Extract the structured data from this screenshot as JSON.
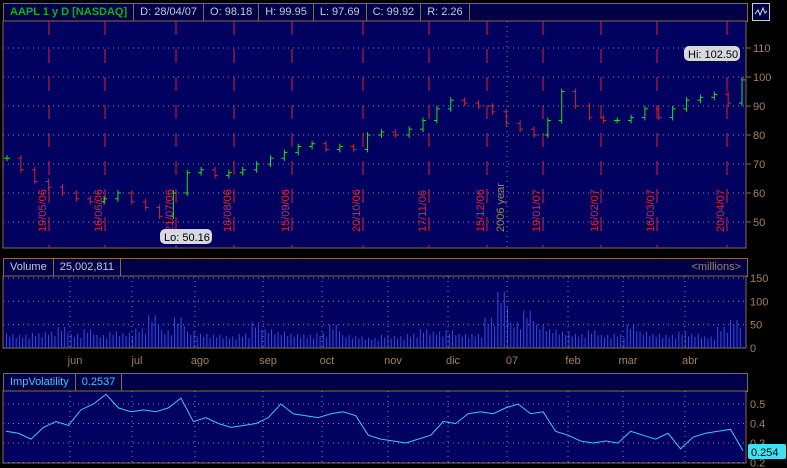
{
  "header": {
    "title": "AAPL 1 y D [NASDAQ]",
    "date": "D: 28/04/07",
    "open": "O: 98.18",
    "high": "H: 99.95",
    "low": "L: 97.69",
    "close": "C: 99.92",
    "range": "R: 2.26"
  },
  "volume_panel": {
    "label": "Volume",
    "value": "25,002,811",
    "units": "<millions>"
  },
  "iv_panel": {
    "label": "ImpVolatility",
    "value": "0.2537",
    "last_tag": "0.254"
  },
  "annotations": {
    "hi": "Hi: 102.50",
    "lo": "Lo: 50.16"
  },
  "colors": {
    "up": "#20e020",
    "down": "#e02020",
    "panel": "#000060",
    "border": "#8a6a3a",
    "volume": "#3050e0",
    "iv": "#40c8f0",
    "date_line": "#e02030"
  },
  "chart_data": [
    {
      "type": "bar",
      "subtype": "ohlc",
      "title": "AAPL 1 y D [NASDAQ]",
      "x_start": "15/05/06",
      "x_end": "28/04/07",
      "interval": "weekly (approx.)",
      "closes": [
        72,
        68,
        64,
        62,
        60,
        58,
        57,
        58,
        60,
        57,
        55,
        52,
        60,
        67,
        68,
        66,
        67,
        68,
        70,
        72,
        74,
        76,
        77,
        75,
        76,
        75,
        80,
        81,
        80,
        82,
        85,
        89,
        92,
        91,
        90,
        88,
        84,
        82,
        80,
        85,
        95,
        90,
        86,
        85,
        85,
        86,
        89,
        86,
        89,
        92,
        93,
        94,
        91,
        99
      ],
      "ylim": [
        40,
        115
      ],
      "yticks": [
        50,
        60,
        70,
        80,
        90,
        100,
        110
      ],
      "date_lines": [
        "19/05/06",
        "16/06/06",
        "21/07/06",
        "18/08/06",
        "15/09/06",
        "20/10/06",
        "17/11/06",
        "15/12/06",
        "19/01/07",
        "16/02/07",
        "16/03/07",
        "20/04/07"
      ],
      "year_marker": "2006 year",
      "hi": 102.5,
      "lo": 50.16,
      "grid": true
    },
    {
      "type": "bar",
      "title": "Volume",
      "ylabel": "<millions>",
      "ylim": [
        0,
        150
      ],
      "yticks": [
        0,
        50,
        100,
        150
      ],
      "months": [
        "jun",
        "jul",
        "ago",
        "sep",
        "oct",
        "nov",
        "dic",
        "07",
        "feb",
        "mar",
        "abr"
      ],
      "values": [
        30,
        28,
        32,
        35,
        45,
        30,
        40,
        28,
        35,
        32,
        42,
        70,
        38,
        65,
        35,
        30,
        28,
        25,
        30,
        55,
        40,
        35,
        30,
        28,
        32,
        50,
        28,
        25,
        22,
        28,
        25,
        30,
        40,
        35,
        38,
        30,
        30,
        65,
        120,
        55,
        80,
        50,
        40,
        35,
        30,
        38,
        28,
        30,
        50,
        35,
        30,
        28,
        35,
        30,
        25,
        45,
        60
      ],
      "grid": true
    },
    {
      "type": "line",
      "title": "ImpVolatility",
      "ylim": [
        0.2,
        0.55
      ],
      "yticks": [
        0.2,
        0.3,
        0.4,
        0.5
      ],
      "values": [
        0.36,
        0.35,
        0.32,
        0.38,
        0.41,
        0.39,
        0.47,
        0.5,
        0.55,
        0.48,
        0.46,
        0.47,
        0.46,
        0.48,
        0.53,
        0.41,
        0.43,
        0.4,
        0.38,
        0.39,
        0.4,
        0.43,
        0.5,
        0.45,
        0.44,
        0.43,
        0.45,
        0.46,
        0.44,
        0.34,
        0.32,
        0.31,
        0.3,
        0.32,
        0.34,
        0.41,
        0.4,
        0.45,
        0.46,
        0.45,
        0.48,
        0.5,
        0.45,
        0.46,
        0.36,
        0.34,
        0.31,
        0.3,
        0.31,
        0.3,
        0.36,
        0.34,
        0.32,
        0.35,
        0.27,
        0.33,
        0.35,
        0.36,
        0.37,
        0.26
      ],
      "last": 0.254,
      "grid": true
    }
  ]
}
